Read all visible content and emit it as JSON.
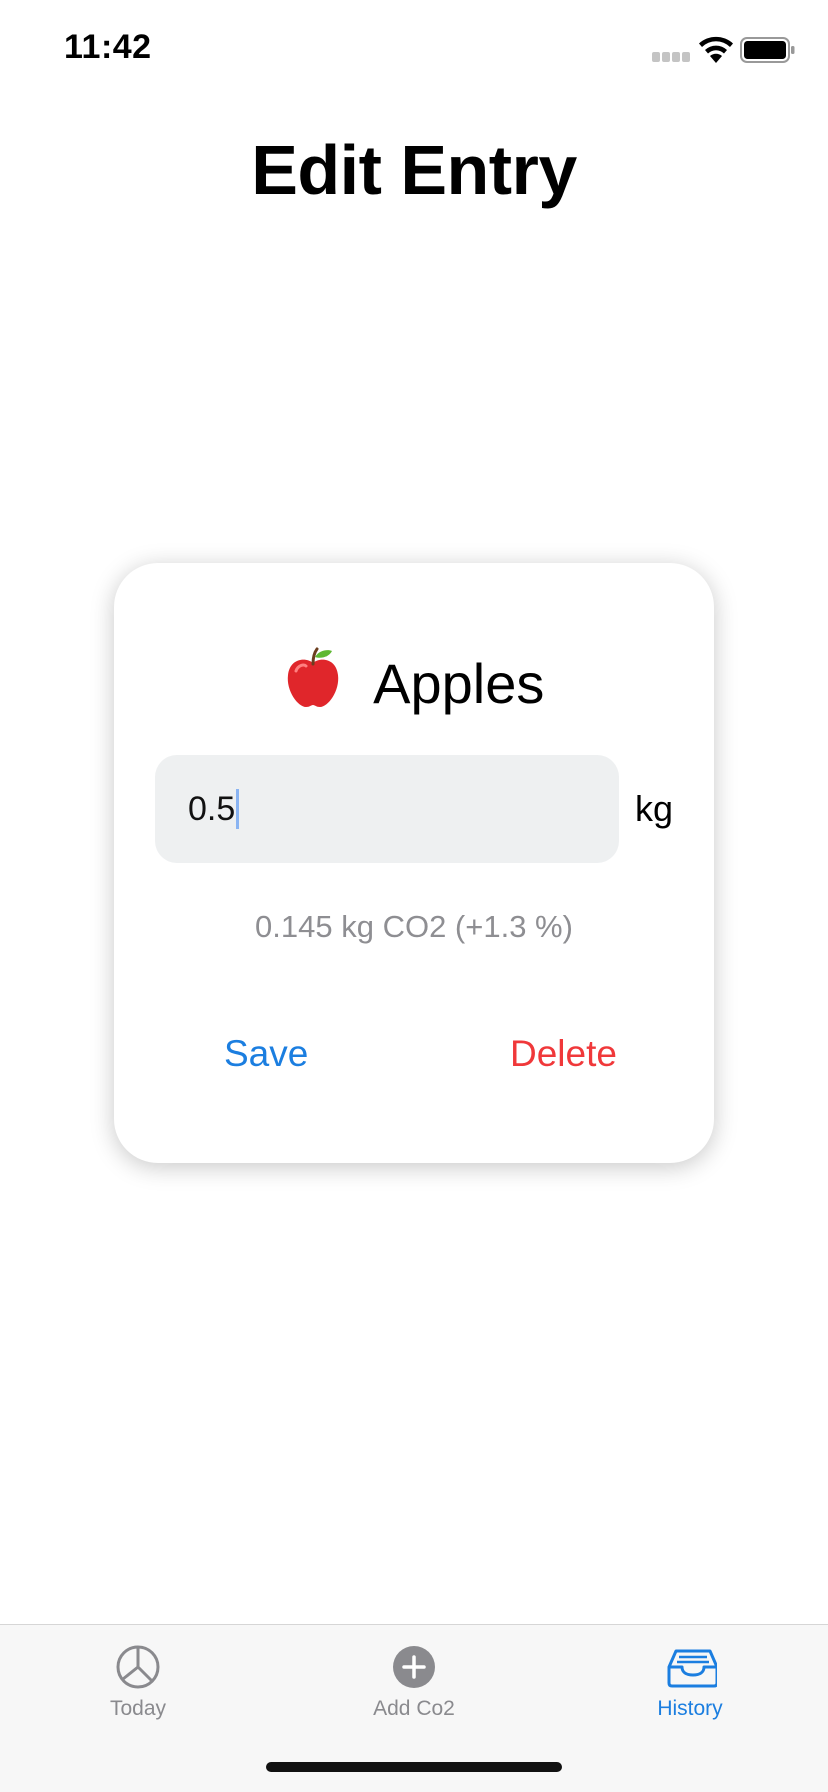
{
  "status_bar": {
    "time": "11:42"
  },
  "header": {
    "title": "Edit Entry"
  },
  "entry_card": {
    "item_icon": "apple-icon",
    "item_name": "Apples",
    "amount_value": "0.5",
    "unit": "kg",
    "co2_summary": "0.145 kg CO2 (+1.3 %)",
    "save_label": "Save",
    "delete_label": "Delete"
  },
  "tab_bar": {
    "tabs": [
      {
        "label": "Today",
        "icon": "pie-chart-icon",
        "active": false
      },
      {
        "label": "Add Co2",
        "icon": "plus-circle-icon",
        "active": false
      },
      {
        "label": "History",
        "icon": "tray-icon",
        "active": true
      }
    ]
  },
  "colors": {
    "accent": "#1b7ee0",
    "destructive": "#f0383a",
    "secondary_text": "#8e8e92",
    "field_background": "#eef0f1",
    "tab_bar_background": "#f7f7f7"
  }
}
